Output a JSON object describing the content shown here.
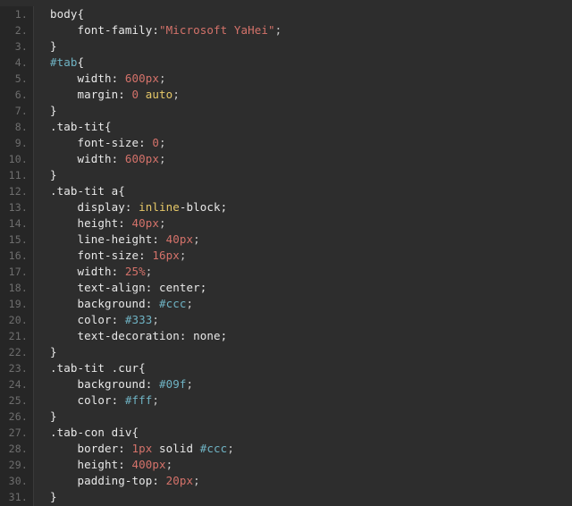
{
  "editor": {
    "language": "css",
    "theme": "dark",
    "background_color": "#2d2d2d",
    "gutter_background_color": "#262626",
    "gutter_text_color": "#6e6e6e",
    "line_number_suffix": ".",
    "first_line_number": 1,
    "last_line_number": 31,
    "total_lines": 31,
    "colors": {
      "text": "#e8e8e8",
      "number": "#d4726a",
      "string": "#d4726a",
      "hex_color": "#6fb3c4",
      "id_selector": "#6fb3c4",
      "keyword": "#e6c868"
    },
    "line_numbers": [
      "1.",
      "2.",
      "3.",
      "4.",
      "5.",
      "6.",
      "7.",
      "8.",
      "9.",
      "10.",
      "11.",
      "12.",
      "13.",
      "14.",
      "15.",
      "16.",
      "17.",
      "18.",
      "19.",
      "20.",
      "21.",
      "22.",
      "23.",
      "24.",
      "25.",
      "26.",
      "27.",
      "28.",
      "29.",
      "30.",
      "31."
    ],
    "lines": [
      {
        "number": "1.",
        "tokens": [
          {
            "t": "body{",
            "c": "plain"
          }
        ]
      },
      {
        "number": "2.",
        "tokens": [
          {
            "t": "    font-family:",
            "c": "prop"
          },
          {
            "t": "\"Microsoft YaHei\"",
            "c": "string"
          },
          {
            "t": ";",
            "c": "punct"
          }
        ]
      },
      {
        "number": "3.",
        "tokens": [
          {
            "t": "}",
            "c": "plain"
          }
        ]
      },
      {
        "number": "4.",
        "tokens": [
          {
            "t": "#tab",
            "c": "sel-id"
          },
          {
            "t": "{",
            "c": "plain"
          }
        ]
      },
      {
        "number": "5.",
        "tokens": [
          {
            "t": "    width: ",
            "c": "prop"
          },
          {
            "t": "600px",
            "c": "num"
          },
          {
            "t": ";",
            "c": "punct"
          }
        ]
      },
      {
        "number": "6.",
        "tokens": [
          {
            "t": "    margin: ",
            "c": "prop"
          },
          {
            "t": "0",
            "c": "num"
          },
          {
            "t": " ",
            "c": "plain"
          },
          {
            "t": "auto",
            "c": "keyword"
          },
          {
            "t": ";",
            "c": "punct"
          }
        ]
      },
      {
        "number": "7.",
        "tokens": [
          {
            "t": "}",
            "c": "plain"
          }
        ]
      },
      {
        "number": "8.",
        "tokens": [
          {
            "t": ".tab-tit{",
            "c": "plain"
          }
        ]
      },
      {
        "number": "9.",
        "tokens": [
          {
            "t": "    font-size: ",
            "c": "prop"
          },
          {
            "t": "0",
            "c": "num"
          },
          {
            "t": ";",
            "c": "punct"
          }
        ]
      },
      {
        "number": "10.",
        "tokens": [
          {
            "t": "    width: ",
            "c": "prop"
          },
          {
            "t": "600px",
            "c": "num"
          },
          {
            "t": ";",
            "c": "punct"
          }
        ]
      },
      {
        "number": "11.",
        "tokens": [
          {
            "t": "}",
            "c": "plain"
          }
        ]
      },
      {
        "number": "12.",
        "tokens": [
          {
            "t": ".tab-tit a{",
            "c": "plain"
          }
        ]
      },
      {
        "number": "13.",
        "tokens": [
          {
            "t": "    display: ",
            "c": "prop"
          },
          {
            "t": "inline",
            "c": "keyword"
          },
          {
            "t": "-block;",
            "c": "plain"
          }
        ]
      },
      {
        "number": "14.",
        "tokens": [
          {
            "t": "    height: ",
            "c": "prop"
          },
          {
            "t": "40px",
            "c": "num"
          },
          {
            "t": ";",
            "c": "punct"
          }
        ]
      },
      {
        "number": "15.",
        "tokens": [
          {
            "t": "    line-height: ",
            "c": "prop"
          },
          {
            "t": "40px",
            "c": "num"
          },
          {
            "t": ";",
            "c": "punct"
          }
        ]
      },
      {
        "number": "16.",
        "tokens": [
          {
            "t": "    font-size: ",
            "c": "prop"
          },
          {
            "t": "16px",
            "c": "num"
          },
          {
            "t": ";",
            "c": "punct"
          }
        ]
      },
      {
        "number": "17.",
        "tokens": [
          {
            "t": "    width: ",
            "c": "prop"
          },
          {
            "t": "25%",
            "c": "num"
          },
          {
            "t": ";",
            "c": "punct"
          }
        ]
      },
      {
        "number": "18.",
        "tokens": [
          {
            "t": "    text-align: center;",
            "c": "plain"
          }
        ]
      },
      {
        "number": "19.",
        "tokens": [
          {
            "t": "    background: ",
            "c": "prop"
          },
          {
            "t": "#ccc",
            "c": "hex"
          },
          {
            "t": ";",
            "c": "punct"
          }
        ]
      },
      {
        "number": "20.",
        "tokens": [
          {
            "t": "    color: ",
            "c": "prop"
          },
          {
            "t": "#333",
            "c": "hex"
          },
          {
            "t": ";",
            "c": "punct"
          }
        ]
      },
      {
        "number": "21.",
        "tokens": [
          {
            "t": "    text-decoration: none;",
            "c": "plain"
          }
        ]
      },
      {
        "number": "22.",
        "tokens": [
          {
            "t": "}",
            "c": "plain"
          }
        ]
      },
      {
        "number": "23.",
        "tokens": [
          {
            "t": ".tab-tit .cur{",
            "c": "plain"
          }
        ]
      },
      {
        "number": "24.",
        "tokens": [
          {
            "t": "    background: ",
            "c": "prop"
          },
          {
            "t": "#09f",
            "c": "hex"
          },
          {
            "t": ";",
            "c": "punct"
          }
        ]
      },
      {
        "number": "25.",
        "tokens": [
          {
            "t": "    color: ",
            "c": "prop"
          },
          {
            "t": "#fff",
            "c": "hex"
          },
          {
            "t": ";",
            "c": "punct"
          }
        ]
      },
      {
        "number": "26.",
        "tokens": [
          {
            "t": "}",
            "c": "plain"
          }
        ]
      },
      {
        "number": "27.",
        "tokens": [
          {
            "t": ".tab-con div{",
            "c": "plain"
          }
        ]
      },
      {
        "number": "28.",
        "tokens": [
          {
            "t": "    border: ",
            "c": "prop"
          },
          {
            "t": "1px",
            "c": "num"
          },
          {
            "t": " solid ",
            "c": "plain"
          },
          {
            "t": "#ccc",
            "c": "hex"
          },
          {
            "t": ";",
            "c": "punct"
          }
        ]
      },
      {
        "number": "29.",
        "tokens": [
          {
            "t": "    height: ",
            "c": "prop"
          },
          {
            "t": "400px",
            "c": "num"
          },
          {
            "t": ";",
            "c": "punct"
          }
        ]
      },
      {
        "number": "30.",
        "tokens": [
          {
            "t": "    padding-top: ",
            "c": "prop"
          },
          {
            "t": "20px",
            "c": "num"
          },
          {
            "t": ";",
            "c": "punct"
          }
        ]
      },
      {
        "number": "31.",
        "tokens": [
          {
            "t": "}",
            "c": "plain"
          }
        ]
      }
    ]
  }
}
